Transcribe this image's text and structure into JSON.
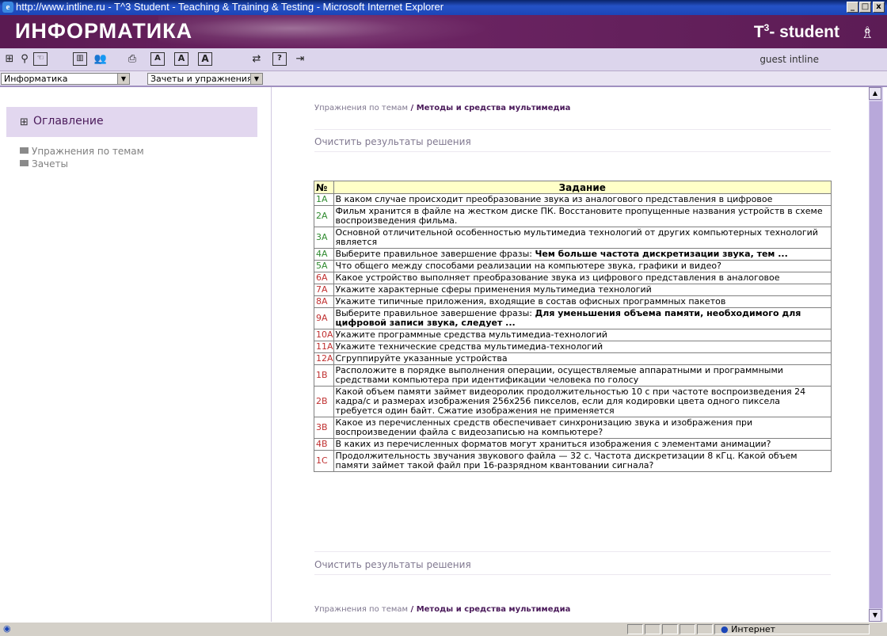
{
  "window": {
    "title": "http://www.intline.ru - T^3 Student - Teaching & Training & Testing - Microsoft Internet Explorer",
    "minimize": "_",
    "maximize": "□",
    "close": "x"
  },
  "header": {
    "logo": "ИНФОРМАТИКА",
    "brand_prefix": "T",
    "brand_sup": "3",
    "brand_suffix": "- student"
  },
  "toolbar": {
    "user": "guest intline",
    "font_small": "A",
    "font_medium": "A",
    "font_large": "A",
    "help": "?"
  },
  "selects": {
    "subject": "Информатика",
    "mode": "Зачеты и упражнения"
  },
  "sidebar": {
    "toc_title": "Оглавление",
    "items": [
      "Упражнения по темам",
      "Зачеты"
    ]
  },
  "main": {
    "breadcrumb_parent": "Упражнения по темам",
    "breadcrumb_sep": " / ",
    "breadcrumb_current": "Методы и средства мультимедиа",
    "clear_results": "Очистить результаты решения",
    "table_headers": [
      "№",
      "Задание"
    ],
    "rows": [
      {
        "num": "1А",
        "color": "green",
        "text": "В каком случае происходит преобразование звука из аналогового представления в цифровое",
        "bold": ""
      },
      {
        "num": "2А",
        "color": "green",
        "text": "Фильм хранится в файле на жестком диске ПК. Восстановите пропущенные названия устройств в схеме воспроизведения фильма.",
        "bold": ""
      },
      {
        "num": "3А",
        "color": "green",
        "text": "Основной отличительной особенностью мультимедиа технологий от других компьютерных технологий является",
        "bold": ""
      },
      {
        "num": "4А",
        "color": "green",
        "text": "Выберите правильное завершение фразы: ",
        "bold": "Чем больше частота дискретизации звука, тем ..."
      },
      {
        "num": "5А",
        "color": "green",
        "text": "Что общего между способами реализации на компьютере звука, графики и видео?",
        "bold": ""
      },
      {
        "num": "6А",
        "color": "red",
        "text": "Какое устройство выполняет преобразование звука из цифрового представления в аналоговое",
        "bold": ""
      },
      {
        "num": "7А",
        "color": "red",
        "text": "Укажите характерные сферы применения мультимедиа технологий",
        "bold": ""
      },
      {
        "num": "8А",
        "color": "red",
        "text": "Укажите типичные приложения, входящие в состав офисных программных пакетов",
        "bold": ""
      },
      {
        "num": "9А",
        "color": "red",
        "text": "Выберите правильное завершение фразы: ",
        "bold": "Для уменьшения объема памяти, необходимого для цифровой записи звука, следует ..."
      },
      {
        "num": "10А",
        "color": "red",
        "text": "Укажите программные средства мультимедиа-технологий",
        "bold": ""
      },
      {
        "num": "11А",
        "color": "red",
        "text": "Укажите технические средства мультимедиа-технологий",
        "bold": ""
      },
      {
        "num": "12А",
        "color": "red",
        "text": "Сгруппируйте указанные устройства",
        "bold": ""
      },
      {
        "num": "1В",
        "color": "red",
        "text": "Расположите в порядке выполнения операции, осуществляемые аппаратными и программными средствами компьютера при идентификации человека по голосу",
        "bold": ""
      },
      {
        "num": "2В",
        "color": "red",
        "text": "Какой объем памяти займет видеоролик продолжительностью 10 с при частоте воспроизведения 24 кадра/с и размерах изображения 256x256 пикселов, если для кодировки цвета одного пиксела требуется один байт. Сжатие изображения не применяется",
        "bold": ""
      },
      {
        "num": "3В",
        "color": "red",
        "text": "Какое из перечисленных средств обеспечивает синхронизацию звука и изображения при воспроизведении файла с видеозаписью на компьютере?",
        "bold": ""
      },
      {
        "num": "4В",
        "color": "red",
        "text": "В каких из перечисленных форматов могут храниться изображения с элементами анимации?",
        "bold": ""
      },
      {
        "num": "1С",
        "color": "red",
        "text": "Продолжительность звучания звукового файла — 32 с. Частота дискретизации 8 кГц. Какой объем памяти займет такой файл при 16-разрядном квантовании сигнала?",
        "bold": ""
      }
    ]
  },
  "statusbar": {
    "zone": "Интернет"
  },
  "colors": {
    "header": "#5a1a52",
    "accent": "#4a1a5a",
    "toolbar": "#dcd5ec",
    "table_header": "#ffffc8",
    "done": "#2e8a2e",
    "undone": "#c03030"
  }
}
